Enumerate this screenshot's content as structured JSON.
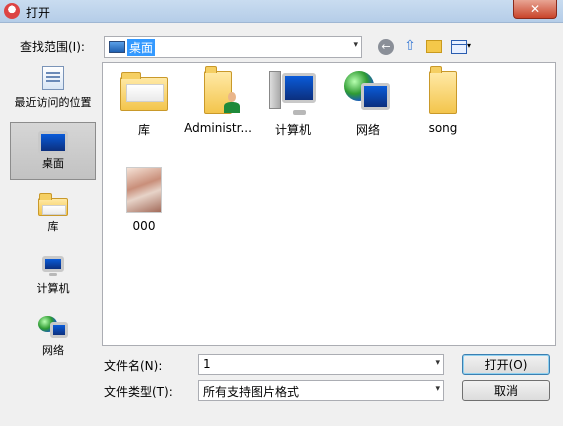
{
  "window": {
    "title": "打开",
    "close_glyph": "✕"
  },
  "toolbar": {
    "lookin_label": "查找范围(I):",
    "lookin_value": "桌面",
    "back_glyph": "←",
    "up_glyph": "⇧",
    "dropdown_glyph": "▾"
  },
  "places": [
    {
      "label": "最近访问的位置",
      "icon": "recent-places-icon"
    },
    {
      "label": "桌面",
      "icon": "desktop-icon",
      "selected": true
    },
    {
      "label": "库",
      "icon": "libraries-icon"
    },
    {
      "label": "计算机",
      "icon": "computer-icon"
    },
    {
      "label": "网络",
      "icon": "network-icon"
    }
  ],
  "files": [
    {
      "label": "库",
      "icon": "libraries-folder-icon"
    },
    {
      "label": "Administr...",
      "icon": "user-folder-icon"
    },
    {
      "label": "计算机",
      "icon": "computer-icon"
    },
    {
      "label": "网络",
      "icon": "network-icon"
    },
    {
      "label": "song",
      "icon": "folder-icon"
    },
    {
      "label": "000",
      "icon": "image-thumbnail-icon"
    }
  ],
  "form": {
    "filename_label": "文件名(N):",
    "filename_value": "1",
    "filetype_label": "文件类型(T):",
    "filetype_value": "所有支持图片格式",
    "open_label": "打开(O)",
    "cancel_label": "取消"
  }
}
